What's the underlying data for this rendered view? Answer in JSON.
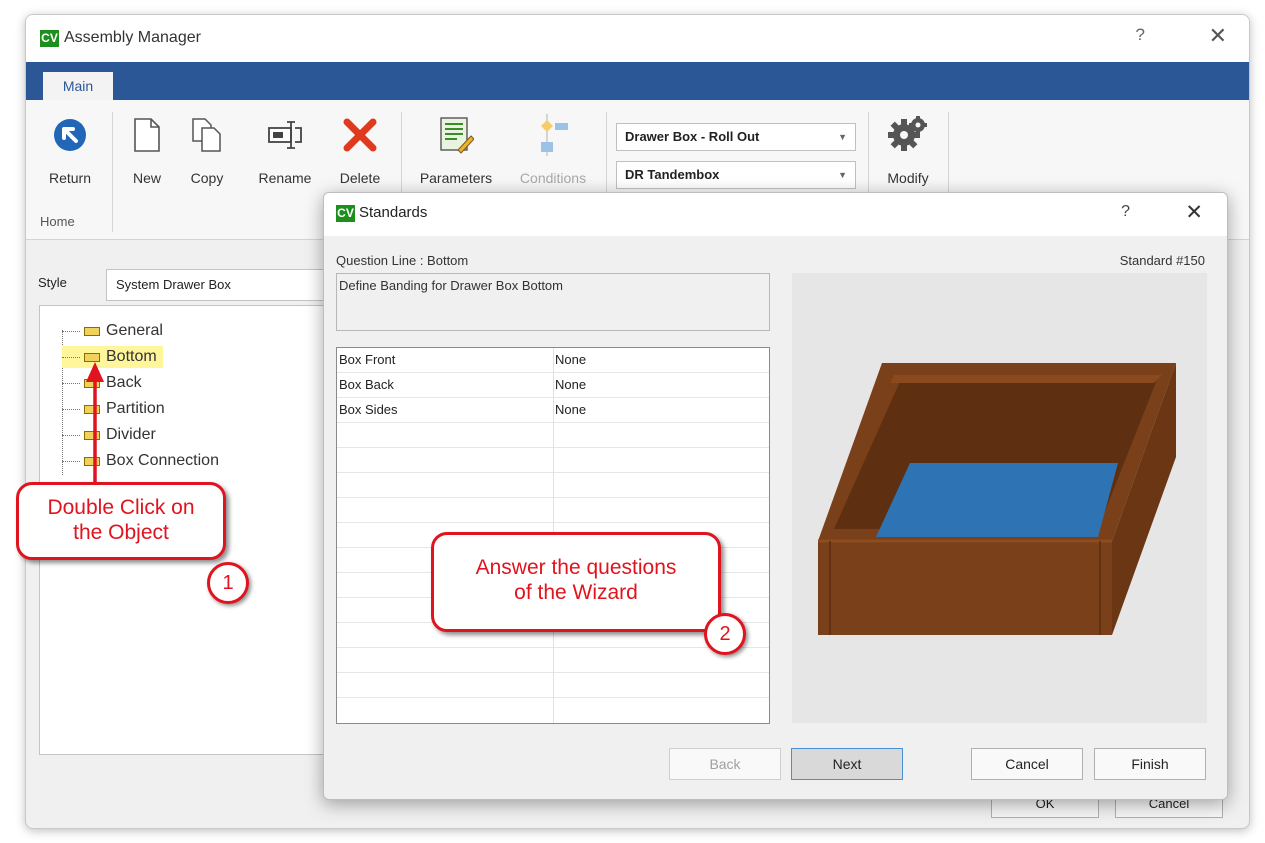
{
  "app": {
    "logo_text": "CV",
    "title": "Assembly Manager",
    "help_glyph": "?",
    "close_glyph": "✕"
  },
  "ribbon": {
    "tab_label": "Main",
    "buttons": {
      "return": "Return",
      "new": "New",
      "copy": "Copy",
      "rename": "Rename",
      "delete": "Delete",
      "parameters": "Parameters",
      "conditions": "Conditions",
      "modify": "Modify"
    },
    "group_label": "Home",
    "combo_assembly": "Drawer Box - Roll Out",
    "combo_hardware": "DR Tandembox"
  },
  "left_panel": {
    "style_label": "Style",
    "style_value": "System Drawer Box",
    "tree_items": [
      "General",
      "Bottom",
      "Back",
      "Partition",
      "Divider",
      "Box Connection"
    ]
  },
  "bottom_buttons": {
    "ok": "OK",
    "cancel": "Cancel"
  },
  "standards_dialog": {
    "logo_text": "CV",
    "title": "Standards",
    "help_glyph": "?",
    "close_glyph": "✕",
    "question_line": "Question Line : Bottom",
    "standard_number": "Standard #150",
    "question_description": "Define Banding for Drawer Box Bottom",
    "rows": [
      {
        "name": "Box Front",
        "value": "None"
      },
      {
        "name": "Box Back",
        "value": "None"
      },
      {
        "name": "Box Sides",
        "value": "None"
      }
    ],
    "buttons": {
      "back": "Back",
      "next": "Next",
      "cancel": "Cancel",
      "finish": "Finish"
    },
    "preview_colors": {
      "box_wood": "#7a4019",
      "box_bottom": "#2e74b5"
    }
  },
  "callouts": {
    "callout1_line1": "Double Click on",
    "callout1_line2": "the Object",
    "callout1_number": "1",
    "callout2_line1": "Answer the questions",
    "callout2_line2": "of the Wizard",
    "callout2_number": "2",
    "accent_color": "#e0141e"
  }
}
